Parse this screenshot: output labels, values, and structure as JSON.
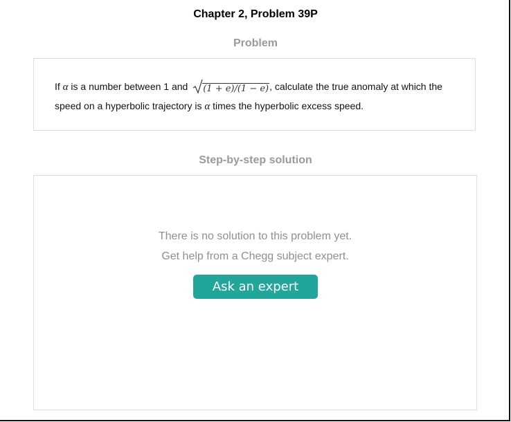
{
  "header": {
    "chapter_title": "Chapter 2, Problem 39P"
  },
  "problem": {
    "heading": "Problem",
    "text_part1": "If ",
    "alpha": "α",
    "text_part2": " is a number between 1 and ",
    "sqrt_radicand": "(1 + e)/(1 − e)",
    "text_part3": ", calculate the true anomaly at which the speed on a hyperbolic trajectory is ",
    "alpha2": "α",
    "text_part4": " times the hyperbolic excess speed."
  },
  "solution": {
    "heading": "Step-by-step solution",
    "no_solution_line1": "There is no solution to this problem yet.",
    "no_solution_line2": "Get help from a Chegg subject expert.",
    "ask_button_label": "Ask an expert"
  },
  "colors": {
    "accent": "#22a59b",
    "heading_gray": "#9a9a9a",
    "border_gray": "#dcdcdc"
  }
}
